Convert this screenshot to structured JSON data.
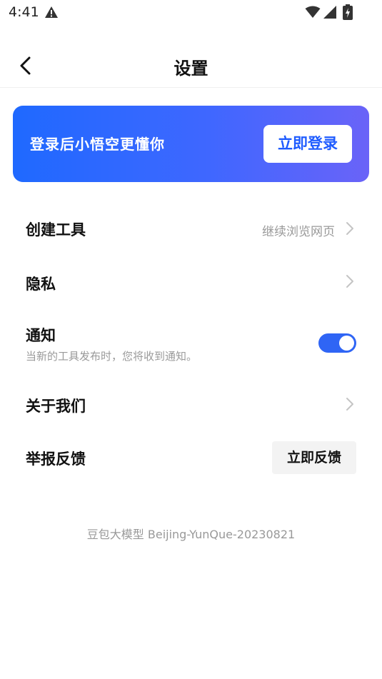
{
  "status_bar": {
    "time": "4:41",
    "icons": [
      "warning-icon",
      "wifi-icon",
      "signal-icon",
      "battery-icon"
    ]
  },
  "header": {
    "title": "设置",
    "back_icon": "chevron-left-icon"
  },
  "login_card": {
    "text": "登录后小悟空更懂你",
    "button_label": "立即登录",
    "gradient": [
      "#1f69ff",
      "#6a63f8"
    ]
  },
  "settings": {
    "create_tool": {
      "label": "创建工具",
      "hint": "继续浏览网页"
    },
    "privacy": {
      "label": "隐私"
    },
    "notification": {
      "label": "通知",
      "description": "当新的工具发布时，您将收到通知。",
      "enabled": true
    },
    "about": {
      "label": "关于我们"
    },
    "report": {
      "label": "举报反馈",
      "button_label": "立即反馈"
    }
  },
  "footer": {
    "version": "豆包大模型 Beijing-YunQue-20230821"
  },
  "colors": {
    "accent": "#2f65f5",
    "hint_text": "#999999"
  }
}
